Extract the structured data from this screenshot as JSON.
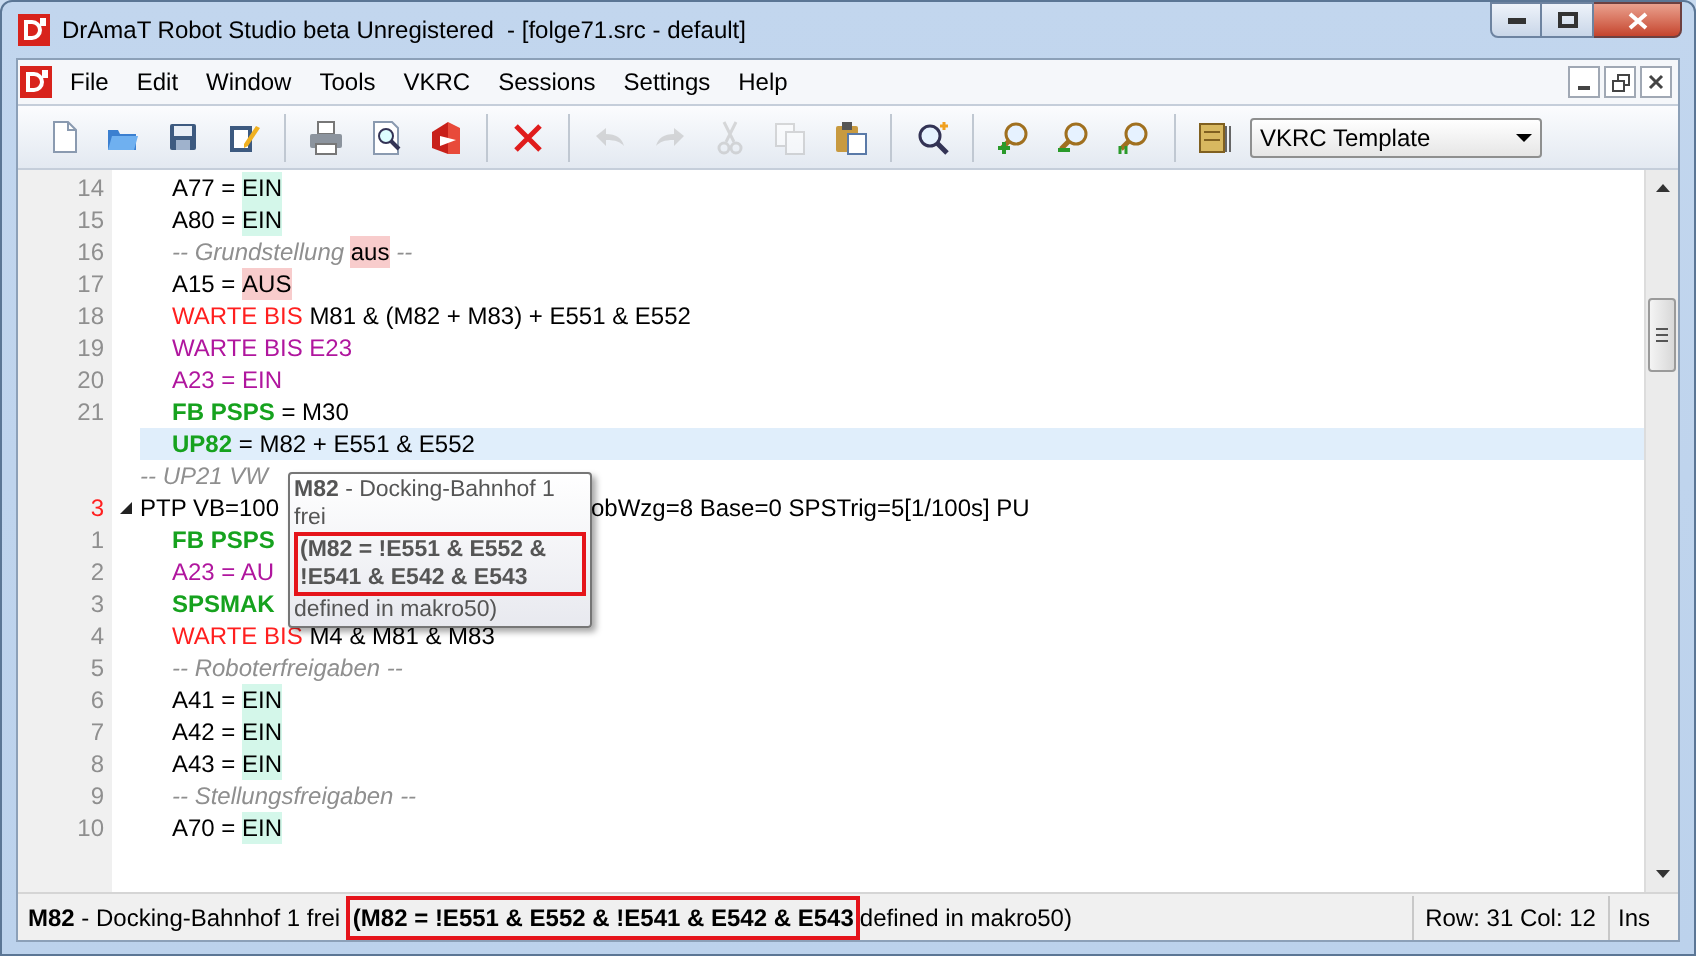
{
  "window": {
    "title": "DrAmaT Robot Studio beta Unregistered  - [folge71.src - default]"
  },
  "menu": [
    "File",
    "Edit",
    "Window",
    "Tools",
    "VKRC",
    "Sessions",
    "Settings",
    "Help"
  ],
  "toolbar": [
    [
      {
        "kind": "new",
        "disabled": false
      },
      {
        "kind": "open",
        "disabled": false
      },
      {
        "kind": "save",
        "disabled": false
      },
      {
        "kind": "edit",
        "disabled": false
      }
    ],
    [
      {
        "kind": "print",
        "disabled": false
      },
      {
        "kind": "preview",
        "disabled": false
      },
      {
        "kind": "export",
        "disabled": false
      }
    ],
    [
      {
        "kind": "delete",
        "disabled": false
      }
    ],
    [
      {
        "kind": "undo",
        "disabled": true
      },
      {
        "kind": "redo",
        "disabled": true
      },
      {
        "kind": "cut",
        "disabled": true
      },
      {
        "kind": "copy",
        "disabled": true
      },
      {
        "kind": "paste",
        "disabled": false
      }
    ],
    [
      {
        "kind": "find",
        "disabled": false
      }
    ],
    [
      {
        "kind": "zoom-in",
        "disabled": false
      },
      {
        "kind": "zoom-out",
        "disabled": false
      },
      {
        "kind": "zoom-reset",
        "disabled": false
      }
    ],
    [
      {
        "kind": "template",
        "disabled": false
      }
    ]
  ],
  "template_select": {
    "value": "VKRC Template"
  },
  "editor": {
    "lines": [
      {
        "children": [
          {
            "number": "14",
            "point": false,
            "current": false,
            "segments": [
              {
                "kind": "text",
                "text": "A77 = "
              },
              {
                "kind": "on",
                "text": "EIN"
              }
            ]
          },
          {
            "number": "15",
            "point": false,
            "current": false,
            "segments": [
              {
                "kind": "text",
                "text": "A80 = "
              },
              {
                "kind": "on",
                "text": "EIN"
              }
            ]
          },
          {
            "number": "16",
            "point": false,
            "current": false,
            "segments": [
              {
                "kind": "comment",
                "text": "-- Grundstellung "
              },
              {
                "kind": "off",
                "text": "aus"
              },
              {
                "kind": "comment",
                "text": " --"
              }
            ]
          },
          {
            "number": "17",
            "point": false,
            "current": false,
            "segments": [
              {
                "kind": "text",
                "text": "A15 = "
              },
              {
                "kind": "off",
                "text": "AUS"
              }
            ]
          },
          {
            "number": "18",
            "point": false,
            "current": false,
            "segments": [
              {
                "kind": "keyword",
                "text": "WARTE BIS "
              },
              {
                "kind": "text",
                "text": "M81 & (M82 + M83) + E551 & E552"
              }
            ]
          },
          {
            "number": "19",
            "point": false,
            "current": false,
            "segments": [
              {
                "kind": "macro",
                "text": "WARTE BIS E23"
              }
            ]
          },
          {
            "number": "20",
            "point": false,
            "current": false,
            "segments": [
              {
                "kind": "macro",
                "text": "A23 = EIN"
              }
            ]
          },
          {
            "number": "21",
            "point": false,
            "current": false,
            "segments": [
              {
                "kind": "function",
                "text": "FB PSPS"
              },
              {
                "kind": "text",
                "text": " = M30"
              }
            ]
          },
          {
            "current": true,
            "segments": [
              {
                "kind": "function",
                "text": "UP82"
              },
              {
                "kind": "text",
                "text": " = M82 + E551 & E552"
              }
            ]
          }
        ]
      },
      {
        "current": false,
        "segments": [
          {
            "kind": "comment",
            "text": "-- UP21 VW"
          }
        ]
      },
      {
        "number": "3",
        "point": true,
        "current": false,
        "expanded": true,
        "segments": [
          {
            "kind": "text",
            "text": "PTP VB=100"
          },
          {
            "kind": "covered"
          },
          {
            "kind": "text",
            "text": "obWzg=8 Base=0 SPSTrig=5[1/100s] PU"
          }
        ],
        "children": [
          {
            "number": "1",
            "point": false,
            "current": false,
            "segments": [
              {
                "kind": "function",
                "text": "FB PSPS"
              }
            ]
          },
          {
            "number": "2",
            "point": false,
            "current": false,
            "segments": [
              {
                "kind": "macro",
                "text": "A23 = AU"
              }
            ]
          },
          {
            "number": "3",
            "point": false,
            "current": false,
            "segments": [
              {
                "kind": "function",
                "text": "SPSMAK"
              }
            ]
          },
          {
            "number": "4",
            "point": false,
            "current": false,
            "segments": [
              {
                "kind": "keyword",
                "text": "WARTE BIS "
              },
              {
                "kind": "text",
                "text": "M4 & M81 & M83"
              }
            ]
          },
          {
            "number": "5",
            "point": false,
            "current": false,
            "segments": [
              {
                "kind": "comment",
                "text": "-- Roboterfreigaben --"
              }
            ]
          },
          {
            "number": "6",
            "point": false,
            "current": false,
            "segments": [
              {
                "kind": "text",
                "text": "A41 = "
              },
              {
                "kind": "on",
                "text": "EIN"
              }
            ]
          },
          {
            "number": "7",
            "point": false,
            "current": false,
            "segments": [
              {
                "kind": "text",
                "text": "A42 = "
              },
              {
                "kind": "on",
                "text": "EIN"
              }
            ]
          },
          {
            "number": "8",
            "point": false,
            "current": false,
            "segments": [
              {
                "kind": "text",
                "text": "A43 = "
              },
              {
                "kind": "on",
                "text": "EIN"
              }
            ]
          },
          {
            "number": "9",
            "point": false,
            "current": false,
            "segments": [
              {
                "kind": "comment",
                "text": "-- Stellungsfreigaben --"
              }
            ]
          },
          {
            "number": "10",
            "point": false,
            "current": false,
            "segments": [
              {
                "kind": "text",
                "text": "A70 = "
              },
              {
                "kind": "on",
                "text": "EIN"
              }
            ]
          }
        ]
      }
    ]
  },
  "tooltip": {
    "description": "**M82** - Docking-Bahnhof 1 frei",
    "definition": "(M82 = !E551 & E552 & !E541 & E542 & E543",
    "source": "defined in makro50)"
  },
  "status_bar": {
    "description": "**M82** - Docking-Bahnhof 1 frei",
    "definition": "(M82 = !E551 & E552 & !E541 & E542 & E543",
    "source": "defined in makro50)",
    "position": "Row: 31 Col: 12",
    "mode": "Ins"
  }
}
